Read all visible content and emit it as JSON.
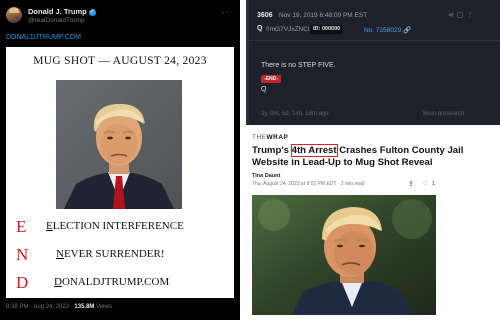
{
  "tweet": {
    "author_name": "Donald J. Trump",
    "verified_mark": "✓",
    "handle": "@realDonaldTrump",
    "more_icon": "···",
    "link_text": "DONALDJTRUMP.COM",
    "poster": {
      "title": "MUG SHOT — AUGUST 24, 2023",
      "end_lines": [
        {
          "letter": "E",
          "first": "E",
          "rest": "LECTION INTERFERENCE"
        },
        {
          "letter": "N",
          "first": "N",
          "rest": "EVER SURRENDER!"
        },
        {
          "letter": "D",
          "first": "D",
          "rest": "ONALDJTRUMP.COM"
        }
      ]
    },
    "timestamp": "9:38 PM · Aug 24, 2023 ·",
    "views_count": "135.8M",
    "views_label": "Views"
  },
  "drop": {
    "number": "3606",
    "date": "Nov 19, 2019 6:48:09 PM EST",
    "author": "Q",
    "tripcode": "!!mG7VJxZNCI",
    "id_badge": "ID: 000000",
    "link": "No. 7358029",
    "body": "There is no STEP FIVE.",
    "tag": "-END-",
    "signature": "Q",
    "age": "3y, 9m, 5d, 14h, 18m ago",
    "source": "8kun qresearch",
    "icons": [
      "share-icon",
      "copy-icon",
      "more-icon"
    ]
  },
  "article": {
    "logo_prefix": "THE",
    "logo_name": "WRAP",
    "headline_before": "Trump's ",
    "headline_boxed": "4th Arrest",
    "headline_after": " Crashes Fulton County Jail Website in Lead-Up to Mug Shot Reveal",
    "author": "Tina Daunt",
    "date": "Thu, August 24, 2023 at 9:02 PM EDT · 2 min read",
    "comment_count": "1"
  },
  "colors": {
    "end_red": "#e0141e",
    "twitter_blue": "#1d9bf0",
    "headline_box": "#d3242b",
    "drop_bg": "#1e2129"
  }
}
